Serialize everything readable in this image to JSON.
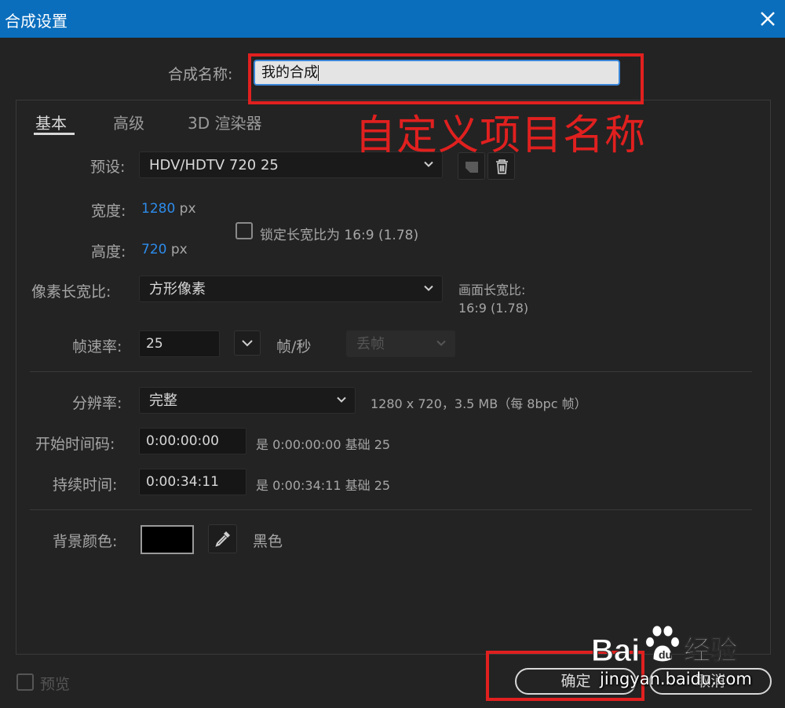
{
  "window": {
    "title": "合成设置"
  },
  "name": {
    "label": "合成名称:",
    "value": "我的合成"
  },
  "annotation": {
    "text": "自定义项目名称",
    "color": "#e0201f"
  },
  "tabs": [
    {
      "label": "基本",
      "active": true
    },
    {
      "label": "高级",
      "active": false
    },
    {
      "label": "3D 渲染器",
      "active": false
    }
  ],
  "preset": {
    "label": "预设:",
    "value": "HDV/HDTV 720 25"
  },
  "width": {
    "label": "宽度:",
    "value": "1280",
    "unit": "px"
  },
  "height": {
    "label": "高度:",
    "value": "720",
    "unit": "px"
  },
  "lock_aspect": {
    "label": "锁定长宽比为 16:9 (1.78)",
    "checked": false
  },
  "pixel_aspect": {
    "label": "像素长宽比:",
    "value": "方形像素"
  },
  "frame_aspect": {
    "label": "画面长宽比:",
    "value": "16:9 (1.78)"
  },
  "frame_rate": {
    "label": "帧速率:",
    "value": "25",
    "unit": "帧/秒",
    "drop_frame": "丢帧"
  },
  "resolution": {
    "label": "分辨率:",
    "value": "完整",
    "info": "1280 x 720，3.5 MB（每 8bpc 帧）"
  },
  "start_timecode": {
    "label": "开始时间码:",
    "value": "0:00:00:00",
    "info": "是 0:00:00:00  基础 25"
  },
  "duration": {
    "label": "持续时间:",
    "value": "0:00:34:11",
    "info": "是 0:00:34:11  基础 25"
  },
  "background": {
    "label": "背景颜色:",
    "color": "#000000",
    "name": "黑色"
  },
  "preview": {
    "label": "预览",
    "checked": false
  },
  "buttons": {
    "ok": "确定",
    "cancel": "取消"
  },
  "watermark": {
    "url": "jingyan.baidu.com",
    "logo": "Bai 经验"
  },
  "accent": "#0a6ebd",
  "icons": [
    "close-icon",
    "chevron-down-icon",
    "new-preset-icon",
    "trash-icon",
    "eyedropper-icon",
    "paw-icon"
  ]
}
